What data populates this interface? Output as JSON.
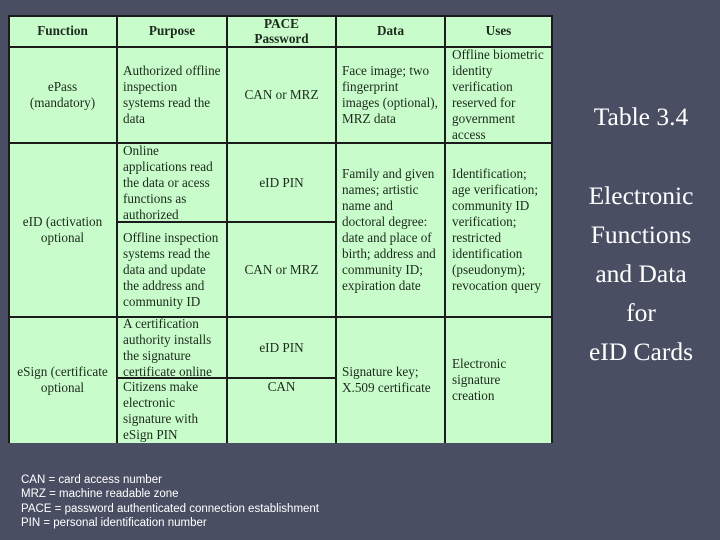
{
  "table": {
    "headers": [
      "Function",
      "Purpose",
      "PACE Password",
      "Data",
      "Uses"
    ],
    "rows": {
      "epass": {
        "function": "ePass (mandatory)",
        "purpose": "Authorized offline inspection systems read the data",
        "pace": "CAN or MRZ",
        "data": "Face image; two fingerprint images (optional), MRZ data",
        "uses": "Offline biometric identity verification reserved for government access"
      },
      "eid": {
        "function": "eID (activation optional",
        "purpose_1": "Online applications read the data or acess functions as authorized",
        "pace_1": "eID PIN",
        "purpose_2": "Offline inspection systems read the data and update the address and community ID",
        "pace_2": "CAN or MRZ",
        "data": "Family and given names; artistic name and doctoral degree: date and place of birth; address and community ID; expiration date",
        "uses": "Identification; age verification; community ID verification; restricted identification (pseudonym); revocation query"
      },
      "esign": {
        "function": "eSign (certificate optional",
        "purpose_1": "A certification authority installs the signature certificate online",
        "pace_1": "eID PIN",
        "purpose_2": "Citizens make electronic signature with eSign PIN",
        "pace_2": "CAN",
        "data": "Signature key; X.509 certificate",
        "uses": "Electronic signature creation"
      }
    }
  },
  "sidebar": {
    "table_number": "Table 3.4",
    "title_lines": [
      "Electronic",
      "Functions",
      "and Data",
      "for",
      "eID Cards"
    ]
  },
  "footnotes": [
    "CAN = card access number",
    "MRZ = machine readable zone",
    "PACE = password authenticated connection establishment",
    "PIN = personal identification number"
  ],
  "colors": {
    "background": "#4a4e63",
    "table_fill": "#c9fccb",
    "text_light": "#ffffff"
  }
}
